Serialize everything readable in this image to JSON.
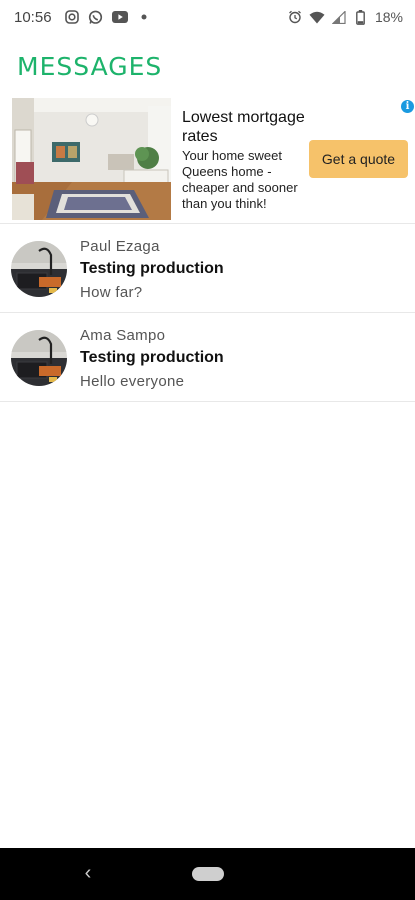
{
  "status_bar": {
    "time": "10:56",
    "left_icons": [
      "instagram-icon",
      "whatsapp-icon",
      "youtube-icon",
      "dot-icon"
    ],
    "right_icons": [
      "alarm-icon",
      "wifi-icon",
      "signal-icon",
      "battery-icon"
    ],
    "battery": "18%"
  },
  "app": {
    "title": "MESSAGES",
    "accent_color": "#1db36b"
  },
  "ad": {
    "headline": "Lowest mortgage rates",
    "body": "Your home sweet Queens home - cheaper and sooner than you think!",
    "cta_label": "Get a quote",
    "cta_color": "#f6c26a",
    "info_icon_label": "i"
  },
  "messages": [
    {
      "sender": "Paul Ezaga",
      "subject": "Testing production",
      "preview": "How far?"
    },
    {
      "sender": "Ama Sampo",
      "subject": "Testing production",
      "preview": "Hello everyone"
    }
  ],
  "nav": {
    "back_glyph": "‹"
  }
}
